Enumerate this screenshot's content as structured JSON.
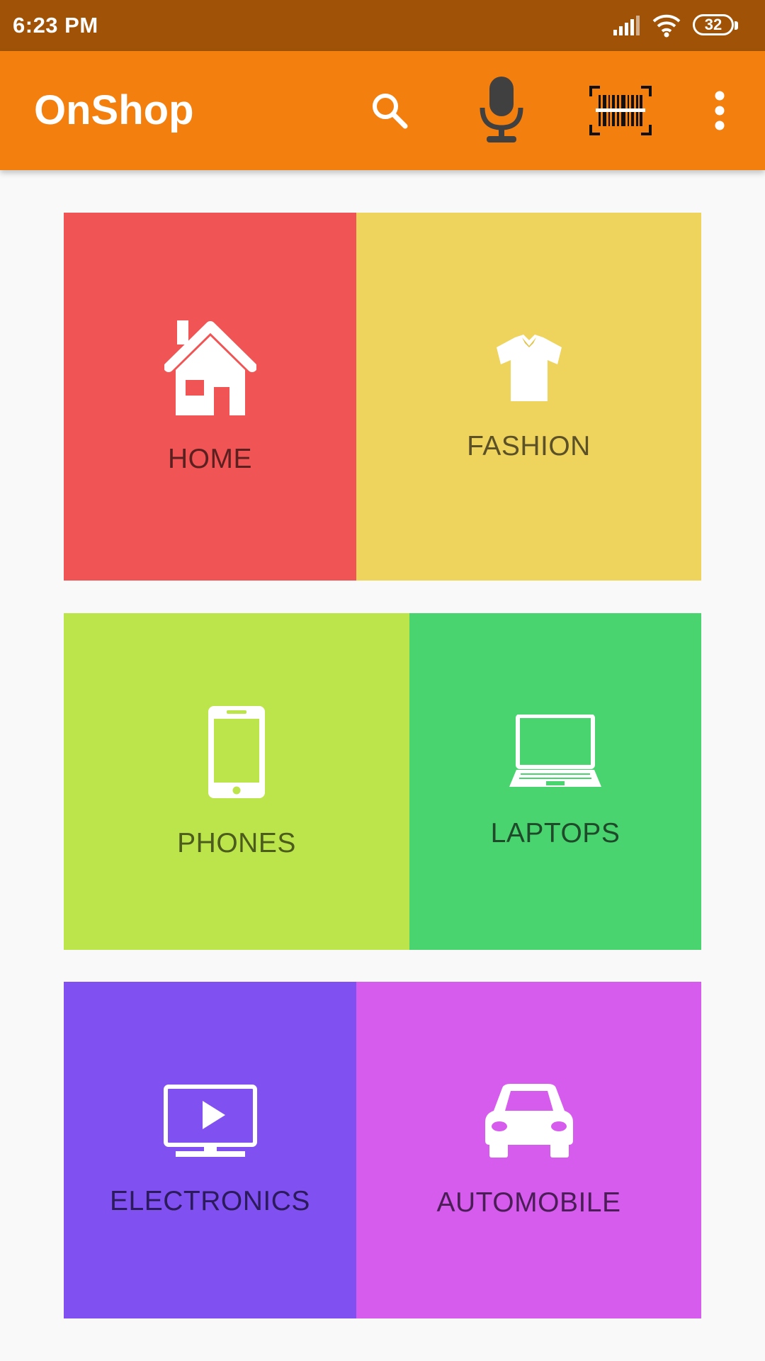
{
  "status_bar": {
    "time": "6:23 PM",
    "battery": "32",
    "icons": [
      "signal-icon",
      "wifi-icon",
      "battery-icon"
    ]
  },
  "app_bar": {
    "title": "OnShop",
    "background": "#f37f0e",
    "actions": [
      "search-icon",
      "microphone-icon",
      "barcode-scanner-icon",
      "more-options-icon"
    ]
  },
  "categories": [
    {
      "label": "HOME",
      "color": "#f05454",
      "icon": "home-icon"
    },
    {
      "label": "FASHION",
      "color": "#eed45d",
      "icon": "shirt-icon"
    },
    {
      "label": "PHONES",
      "color": "#bce44b",
      "icon": "smartphone-icon"
    },
    {
      "label": "LAPTOPS",
      "color": "#49d46f",
      "icon": "laptop-icon"
    },
    {
      "label": "ELECTRONICS",
      "color": "#8051f0",
      "icon": "tv-play-icon"
    },
    {
      "label": "AUTOMOBILE",
      "color": "#d65ced",
      "icon": "car-icon"
    }
  ]
}
